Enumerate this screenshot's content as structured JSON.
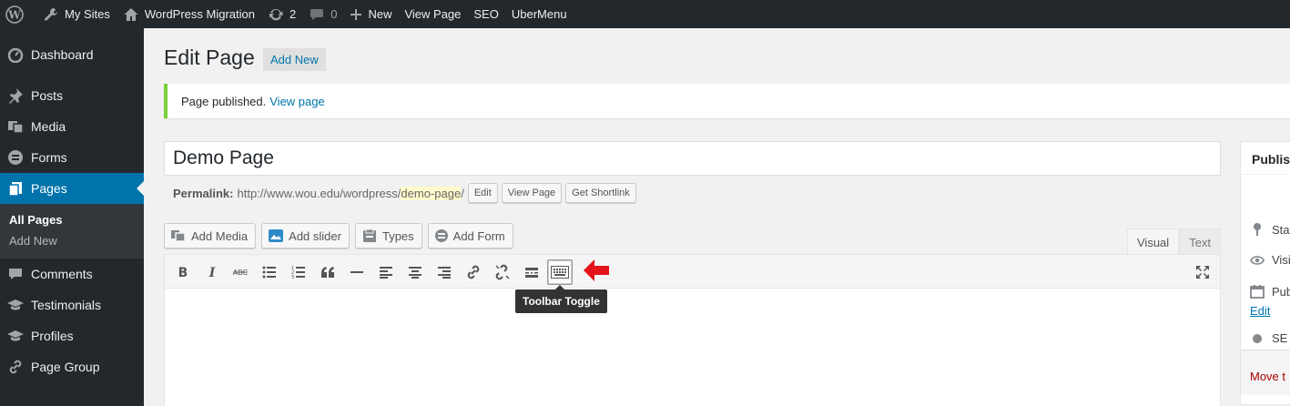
{
  "adminbar": {
    "my_sites": "My Sites",
    "site_name": "WordPress Migration",
    "updates_count": "2",
    "comments_count": "0",
    "new_label": "New",
    "view_page": "View Page",
    "seo": "SEO",
    "ubermenu": "UberMenu"
  },
  "sidebar": {
    "items": [
      {
        "label": "Dashboard",
        "icon": "dashboard-icon"
      },
      {
        "label": "Posts",
        "icon": "pin-icon"
      },
      {
        "label": "Media",
        "icon": "media-icon"
      },
      {
        "label": "Forms",
        "icon": "forms-icon"
      },
      {
        "label": "Pages",
        "icon": "pages-icon"
      },
      {
        "label": "Comments",
        "icon": "comment-icon"
      },
      {
        "label": "Testimonials",
        "icon": "graduation-cap-icon"
      },
      {
        "label": "Profiles",
        "icon": "graduation-cap-icon"
      },
      {
        "label": "Page Group",
        "icon": "link-icon"
      }
    ],
    "submenu": [
      "All Pages",
      "Add New"
    ]
  },
  "main": {
    "title": "Edit Page",
    "add_new": "Add New",
    "notice_text": "Page published.",
    "notice_link": "View page",
    "post_title": "Demo Page",
    "permalink_label": "Permalink:",
    "permalink_base": "http://www.wou.edu/wordpress/",
    "permalink_slug": "demo-page",
    "permalink_end": "/",
    "edit_btn": "Edit",
    "view_page_btn": "View Page",
    "shortlink_btn": "Get Shortlink",
    "media_buttons": [
      "Add Media",
      "Add slider",
      "Types",
      "Add Form"
    ],
    "tabs": {
      "visual": "Visual",
      "text": "Text"
    },
    "tooltip": "Toolbar Toggle"
  },
  "publish": {
    "heading": "Publis",
    "status": "Stat",
    "visibility": "Visi",
    "published": "Pub",
    "edit": "Edit",
    "seo": "SE",
    "trash": "Move t"
  },
  "colors": {
    "adminbar_bg": "#23282d",
    "accent": "#0073aa",
    "notice_green": "#7ad03a",
    "arrow_red": "#e3141b"
  }
}
